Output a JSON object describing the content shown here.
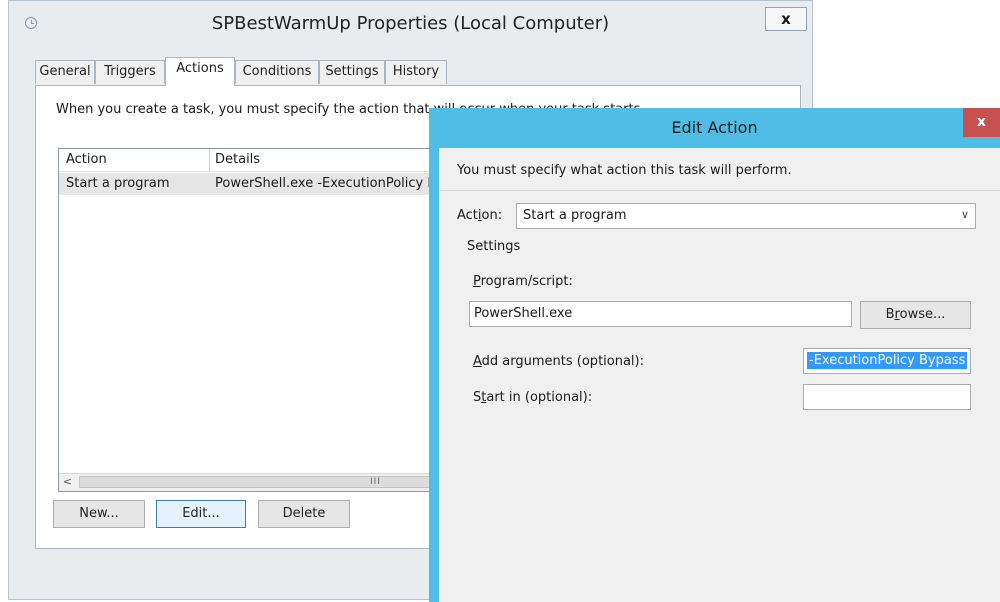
{
  "properties_window": {
    "title": "SPBestWarmUp Properties (Local Computer)",
    "close_label": "x",
    "tabs": [
      {
        "label": "General"
      },
      {
        "label": "Triggers"
      },
      {
        "label": "Actions"
      },
      {
        "label": "Conditions"
      },
      {
        "label": "Settings"
      },
      {
        "label": "History"
      }
    ],
    "active_tab": "Actions",
    "description": "When you create a task, you must specify the action that will occur when your task starts.",
    "list": {
      "columns": [
        "Action",
        "Details"
      ],
      "rows": [
        {
          "action": "Start a program",
          "details": "PowerShell.exe -ExecutionPolicy Bypass"
        }
      ]
    },
    "buttons": {
      "new": "New...",
      "edit": "Edit...",
      "delete": "Delete"
    },
    "scroll_left": "<",
    "scroll_grip": "III"
  },
  "edit_action_dialog": {
    "title": "Edit Action",
    "close_label": "x",
    "instruction": "You must specify what action this task will perform.",
    "action_label_pre": "Act",
    "action_label_access": "i",
    "action_label_post": "on:",
    "action_value": "Start a program",
    "dropdown_arrow": "∨",
    "settings_label": "Settings",
    "program_label_access": "P",
    "program_label_rest": "rogram/script:",
    "program_value": "PowerShell.exe",
    "browse_pre": "B",
    "browse_access": "r",
    "browse_post": "owse...",
    "arguments_label_access": "A",
    "arguments_label_rest": "dd arguments (optional):",
    "arguments_value": "-ExecutionPolicy Bypass",
    "start_in_label_pre": "S",
    "start_in_label_access": "t",
    "start_in_label_post": "art in (optional):",
    "start_in_value": ""
  },
  "colors": {
    "dialog_frame": "#4fbde6",
    "close_button_red": "#c75050",
    "selection_blue": "#3399ff"
  }
}
